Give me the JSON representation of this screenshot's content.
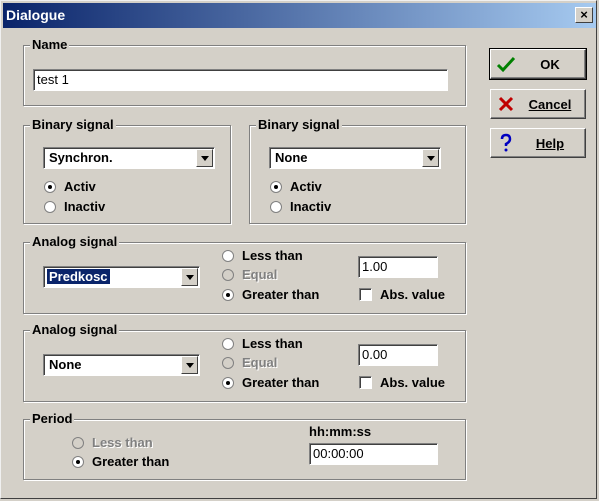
{
  "window": {
    "title": "Dialogue",
    "close_glyph": "×"
  },
  "name_group": {
    "legend": "Name",
    "value": "test 1"
  },
  "binary1": {
    "legend": "Binary signal",
    "selected": "Synchron.",
    "options": [
      {
        "label": "Activ",
        "checked": true
      },
      {
        "label": "Inactiv",
        "checked": false
      }
    ]
  },
  "binary2": {
    "legend": "Binary signal",
    "selected": "None",
    "options": [
      {
        "label": "Activ",
        "checked": true
      },
      {
        "label": "Inactiv",
        "checked": false
      }
    ]
  },
  "analog1": {
    "legend": "Analog signal",
    "selected": "Predkosc",
    "less": "Less than",
    "equal": "Equal",
    "greater": "Greater than",
    "value": "1.00",
    "abs_label": "Abs. value",
    "abs_checked": false,
    "compare": "greater"
  },
  "analog2": {
    "legend": "Analog signal",
    "selected": "None",
    "less": "Less than",
    "equal": "Equal",
    "greater": "Greater than",
    "value": "0.00",
    "abs_label": "Abs. value",
    "abs_checked": false,
    "compare": "greater"
  },
  "period": {
    "legend": "Period",
    "less": "Less than",
    "greater": "Greater than",
    "time_label": "hh:mm:ss",
    "time_value": "00:00:00",
    "compare": "greater"
  },
  "buttons": {
    "ok": "OK",
    "cancel": "Cancel",
    "help": "Help"
  },
  "icons": {
    "ok": "checkmark-icon",
    "cancel": "x-icon",
    "help": "question-icon"
  },
  "colors": {
    "titlebar_start": "#0a246a",
    "titlebar_end": "#a6caf0",
    "ok_check": "#008000",
    "cancel_x": "#c00000",
    "help_q": "#0000c0"
  }
}
